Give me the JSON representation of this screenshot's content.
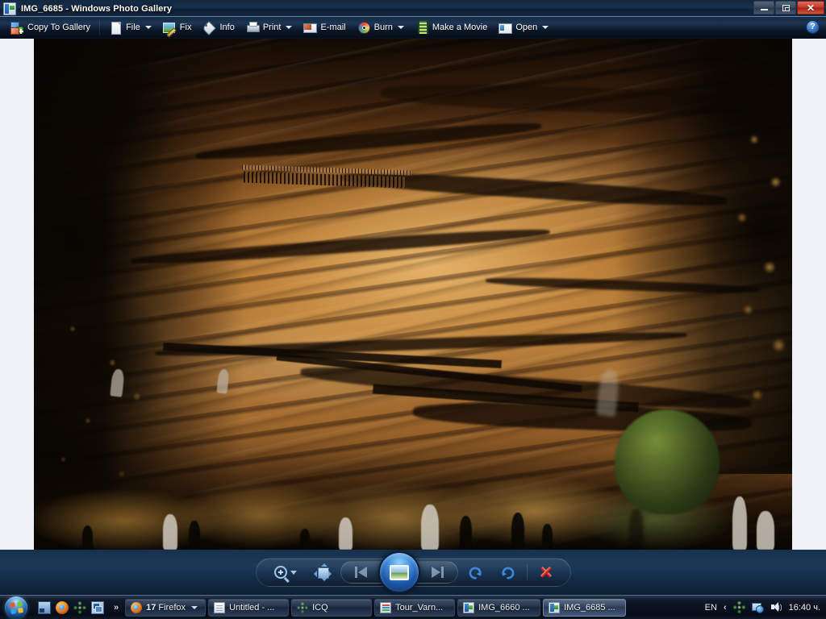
{
  "window": {
    "title": "IMG_6685 - Windows Photo Gallery",
    "icon": "photo-gallery-icon",
    "buttons": {
      "minimize": "Minimize",
      "restore": "Restore",
      "close": "Close"
    }
  },
  "toolbar": {
    "items": [
      {
        "label": "Copy To Gallery",
        "icon": "copy-to-gallery-icon",
        "has_caret": false
      },
      {
        "label": "File",
        "icon": "file-icon",
        "has_caret": true
      },
      {
        "label": "Fix",
        "icon": "fix-icon",
        "has_caret": false
      },
      {
        "label": "Info",
        "icon": "info-tag-icon",
        "has_caret": false
      },
      {
        "label": "Print",
        "icon": "printer-icon",
        "has_caret": true
      },
      {
        "label": "E-mail",
        "icon": "email-icon",
        "has_caret": false
      },
      {
        "label": "Burn",
        "icon": "burn-disc-icon",
        "has_caret": true
      },
      {
        "label": "Make a Movie",
        "icon": "movie-film-icon",
        "has_caret": false
      },
      {
        "label": "Open",
        "icon": "open-window-icon",
        "has_caret": true
      }
    ],
    "help_label": "?"
  },
  "photo": {
    "description": "Night photograph of a floodlit limestone cliff and cave face with people silhouetted in the foreground",
    "background_color": "#eef2f7"
  },
  "controls": {
    "zoom": {
      "name": "Change the display size",
      "icon": "magnifier-plus-icon",
      "has_caret": true
    },
    "fit": {
      "name": "Fit to window",
      "icon": "fit-to-window-icon"
    },
    "previous": {
      "name": "Previous",
      "icon": "skip-previous-icon"
    },
    "play": {
      "name": "Play slide show",
      "icon": "slideshow-play-icon"
    },
    "next": {
      "name": "Next",
      "icon": "skip-next-icon"
    },
    "rotate_ccw": {
      "name": "Rotate counterclockwise",
      "icon": "rotate-left-icon"
    },
    "rotate_cw": {
      "name": "Rotate clockwise",
      "icon": "rotate-right-icon"
    },
    "delete": {
      "name": "Delete",
      "icon": "delete-x-icon"
    }
  },
  "taskbar": {
    "start": "Start",
    "quick_launch": [
      {
        "name": "show-desktop",
        "icon": "show-desktop-icon"
      },
      {
        "name": "firefox",
        "icon": "firefox-icon"
      },
      {
        "name": "icq",
        "icon": "icq-icon"
      },
      {
        "name": "switch-windows",
        "icon": "switch-windows-icon"
      }
    ],
    "quick_launch_overflow": "»",
    "tasks": [
      {
        "count": "17",
        "label": "Firefox",
        "icon": "firefox-icon",
        "has_caret": true,
        "active": false
      },
      {
        "count": "",
        "label": "Untitled - ...",
        "icon": "notepad-icon",
        "has_caret": false,
        "active": false
      },
      {
        "count": "",
        "label": "ICQ",
        "icon": "icq-icon",
        "has_caret": false,
        "active": false
      },
      {
        "count": "",
        "label": "Tour_Varn...",
        "icon": "book-icon",
        "has_caret": false,
        "active": false
      },
      {
        "count": "",
        "label": "IMG_6660 ...",
        "icon": "photo-gallery-icon",
        "has_caret": false,
        "active": false
      },
      {
        "count": "",
        "label": "IMG_6685 ...",
        "icon": "photo-gallery-icon",
        "has_caret": false,
        "active": true
      }
    ],
    "tray": {
      "language": "EN",
      "chevron": "‹",
      "icons": [
        {
          "name": "icq-tray-icon"
        },
        {
          "name": "network-icon"
        },
        {
          "name": "volume-icon"
        }
      ],
      "clock": "16:40 ч."
    }
  },
  "colors": {
    "accent": "#1d5fa8",
    "close_button": "#c43a28",
    "viewer_background": "#eef2f7",
    "photo_warm": "#c98e45"
  }
}
